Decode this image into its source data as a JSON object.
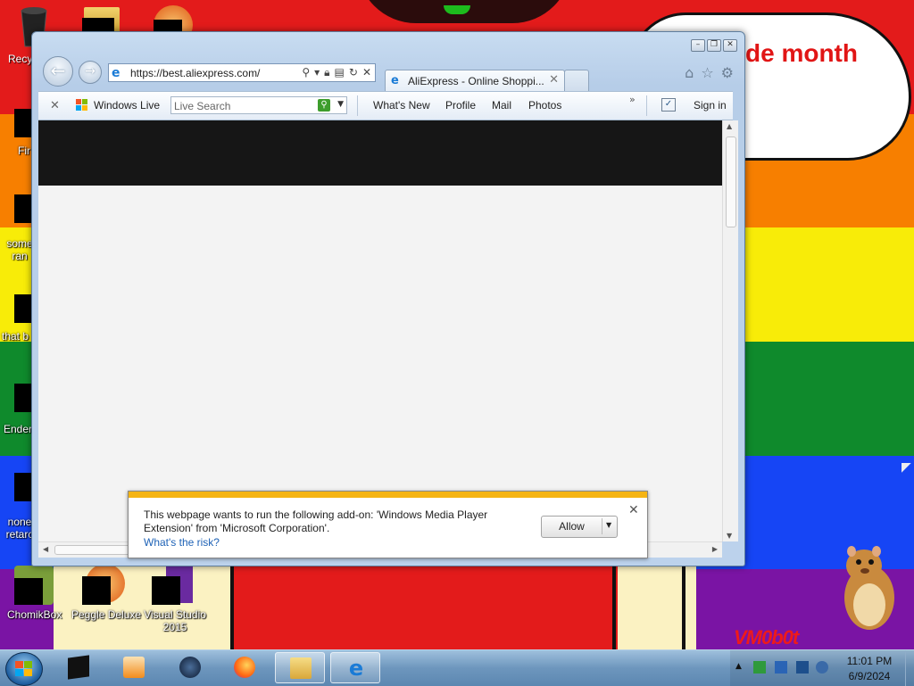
{
  "desktop": {
    "bubble_text": [
      "de month",
      "!"
    ],
    "wallpaper_text": "VM0b0t",
    "icons": [
      {
        "label": "Recy"
      },
      {
        "label": "Fir"
      },
      {
        "label": "some\nran"
      },
      {
        "label": "that b"
      },
      {
        "label": "Ender"
      },
      {
        "label": "none\nretarc"
      },
      {
        "label": "ChomikBox"
      },
      {
        "label": "Peggle Deluxe"
      },
      {
        "label": "Visual Studio\n2015"
      }
    ]
  },
  "browser": {
    "address_url": "https://best.aliexpress.com/",
    "tab_title": "AliExpress - Online Shoppi...",
    "command_bar": {
      "windows_live": "Windows Live",
      "search_placeholder": "Live Search",
      "links": [
        "What's New",
        "Profile",
        "Mail",
        "Photos"
      ],
      "chevron": "»",
      "sign_in": "Sign in"
    },
    "notification": {
      "message": "This webpage wants to run the following add-on: 'Windows Media Player Extension' from 'Microsoft Corporation'.",
      "risk_link": "What's the risk?",
      "allow_label": "Allow"
    }
  },
  "taskbar": {
    "time": "11:01 PM",
    "date": "6/9/2024"
  },
  "colors": {
    "notification_bar": "#f5b414",
    "page_header": "#161616"
  }
}
